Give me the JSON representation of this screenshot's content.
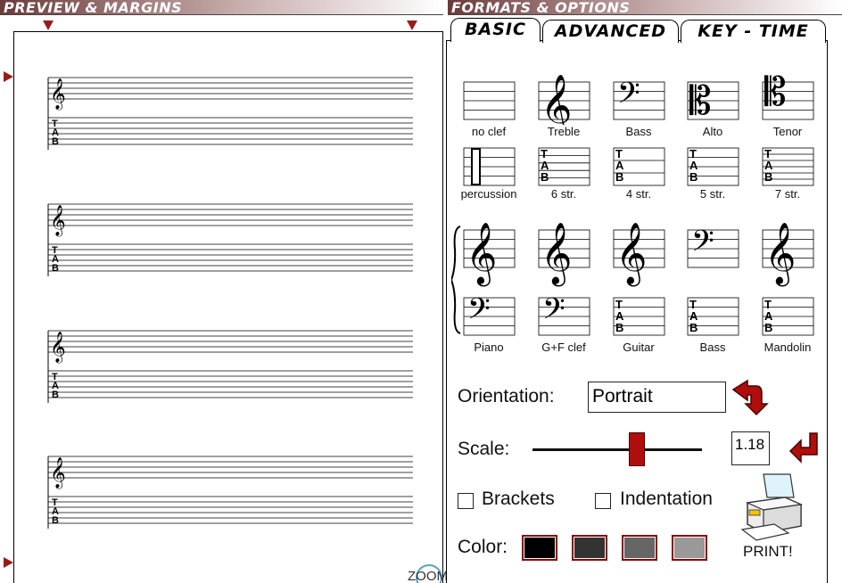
{
  "headers": {
    "preview": "PREVIEW & MARGINS",
    "formats": "FORMATS & OPTIONS"
  },
  "tabs": [
    {
      "label": "BASIC",
      "selected": true
    },
    {
      "label": "ADVANCED",
      "selected": false
    },
    {
      "label": "KEY - TIME",
      "selected": false
    }
  ],
  "clefs": {
    "row1": [
      "no clef",
      "Treble",
      "Bass",
      "Alto",
      "Tenor"
    ],
    "row2": [
      "percussion",
      "6 str.",
      "4 str.",
      "5 str.",
      "7 str."
    ],
    "row3": [
      "Piano",
      "G+F clef",
      "Guitar",
      "Bass",
      "Mandolin"
    ]
  },
  "orientation": {
    "label": "Orientation:",
    "value": "Portrait"
  },
  "scale": {
    "label": "Scale:",
    "value": "1.18",
    "slider_fraction": 0.57
  },
  "options": {
    "brackets": "Brackets",
    "indentation": "Indentation"
  },
  "color": {
    "label": "Color:",
    "swatches": [
      "#000000",
      "#333333",
      "#666666",
      "#999999"
    ]
  },
  "print_label": "PRINT!",
  "zoom_label": "ZOOM",
  "tab_letters": [
    "T",
    "A",
    "B"
  ],
  "accent": "#9b1b1b",
  "icons": [
    "orientation-rotate-icon",
    "scale-apply-icon",
    "printer-icon",
    "margin-marker-icon"
  ]
}
